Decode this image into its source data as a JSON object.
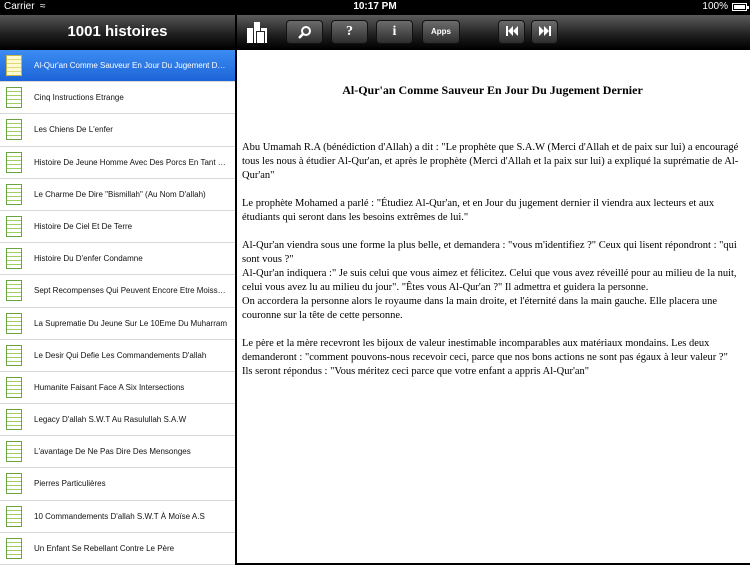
{
  "status_bar": {
    "carrier": "Carrier",
    "time": "10:17 PM",
    "battery": "100%"
  },
  "sidebar": {
    "title": "1001 histoires",
    "items": [
      {
        "label": "Al-Qur'an Comme Sauveur En Jour Du Jugement Dernier",
        "selected": true
      },
      {
        "label": "Cinq Instructions Etrange"
      },
      {
        "label": "Les Chiens De L'enfer"
      },
      {
        "label": "Histoire De Jeune Homme Avec Des Porcs En Tant Que Berger"
      },
      {
        "label": "Le Charme De Dire \"Bismillah\" (Au Nom D'allah)"
      },
      {
        "label": "Histoire De Ciel Et De Terre"
      },
      {
        "label": "Histoire Du D'enfer Condamne"
      },
      {
        "label": "Sept Recompenses Qui Peuvent Encore Etre Moissonnees"
      },
      {
        "label": "La Suprematie Du Jeune Sur Le 10Eme Du Muharram"
      },
      {
        "label": "Le Desir Qui Defie Les Commandements D'allah"
      },
      {
        "label": "Humanite Faisant Face A Six Intersections"
      },
      {
        "label": "Legacy D'allah S.W.T Au Rasulullah S.A.W"
      },
      {
        "label": "L'avantage De Ne Pas Dire Des Mensonges"
      },
      {
        "label": "Pierres Particulières"
      },
      {
        "label": "10 Commandements D'allah S.W.T À Moïse A.S"
      },
      {
        "label": "Un Enfant Se Rebellant Contre Le Père"
      }
    ]
  },
  "toolbar": {
    "search_icon": "magnifier-icon",
    "help_label": "?",
    "info_label": "i",
    "apps_label": "Apps",
    "prev_icon": "skip-back-icon",
    "next_icon": "skip-forward-icon"
  },
  "article": {
    "title": "Al-Qur'an Comme Sauveur En Jour Du Jugement Dernier",
    "paragraphs": [
      "Abu Umamah R.A (bénédiction d'Allah) a dit : \"Le prophète que S.A.W (Merci d'Allah et de paix sur lui) a encouragé tous les nous à étudier Al-Qur'an, et après le prophète (Merci d'Allah et la paix sur lui) a expliqué la suprématie de Al-Qur'an\"",
      "Le prophète Mohamed a parlé : \"Étudiez Al-Qur'an, et en Jour du jugement dernier il viendra aux lecteurs et aux étudiants qui seront dans les besoins extrêmes de lui.\"",
      "Al-Qur'an viendra sous une forme la plus belle, et demandera : \"vous m'identifiez ?\" Ceux qui lisent répondront : \"qui sont vous ?\"\nAl-Qur'an indiquera :\" Je suis celui que vous aimez et félicitez. Celui que vous avez réveillé pour au milieu de la nuit, celui vous avez lu au milieu du jour\".  \"Êtes vous Al-Qur'an ?\" Il admettra et guidera la personne.\nOn accordera la personne alors le royaume dans la main droite, et l'éternité dans la main gauche. Elle placera une couronne sur la tête de cette personne.",
      "Le père et la mère recevront les bijoux de valeur inestimable incomparables aux matériaux mondains. Les deux demanderont : \"comment pouvons-nous recevoir ceci, parce que nos bons actions ne sont pas égaux à leur valeur ?\"\nIls seront répondus : \"Vous méritez ceci parce que votre enfant a appris Al-Qur'an\""
    ]
  }
}
